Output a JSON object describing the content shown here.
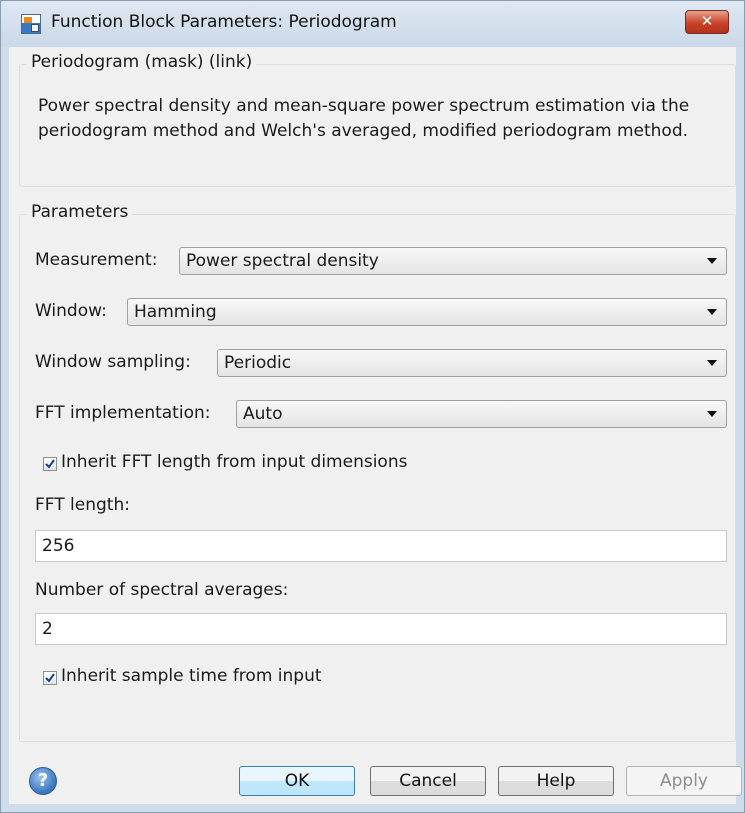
{
  "window": {
    "title": "Function Block Parameters: Periodogram",
    "close_glyph": "✕"
  },
  "mask": {
    "legend": "Periodogram (mask) (link)",
    "description": "Power spectral density and mean-square power spectrum estimation via the periodogram method and Welch's averaged, modified periodogram method."
  },
  "parameters": {
    "legend": "Parameters",
    "measurement": {
      "label": "Measurement:",
      "value": "Power spectral density"
    },
    "window": {
      "label": "Window:",
      "value": "Hamming"
    },
    "window_sampling": {
      "label": "Window sampling:",
      "value": "Periodic"
    },
    "fft_implementation": {
      "label": "FFT implementation:",
      "value": "Auto"
    },
    "inherit_fft_length": {
      "label": "Inherit FFT length from input dimensions",
      "checked": true
    },
    "fft_length": {
      "label": "FFT length:",
      "value": "256"
    },
    "spectral_averages": {
      "label": "Number of spectral averages:",
      "value": "2"
    },
    "inherit_sample_time": {
      "label": "Inherit sample time from input",
      "checked": true
    }
  },
  "buttons": {
    "help_icon": "?",
    "ok": "OK",
    "cancel": "Cancel",
    "help": "Help",
    "apply": "Apply",
    "apply_enabled": false
  },
  "icons": {
    "app": "simulink-block-icon",
    "close": "close-icon",
    "help": "help-icon",
    "checkbox": "checkmark-icon"
  },
  "colors": {
    "frame": "#cfdcea",
    "close_button": "#c9432b",
    "default_button": "#bee6fd"
  }
}
